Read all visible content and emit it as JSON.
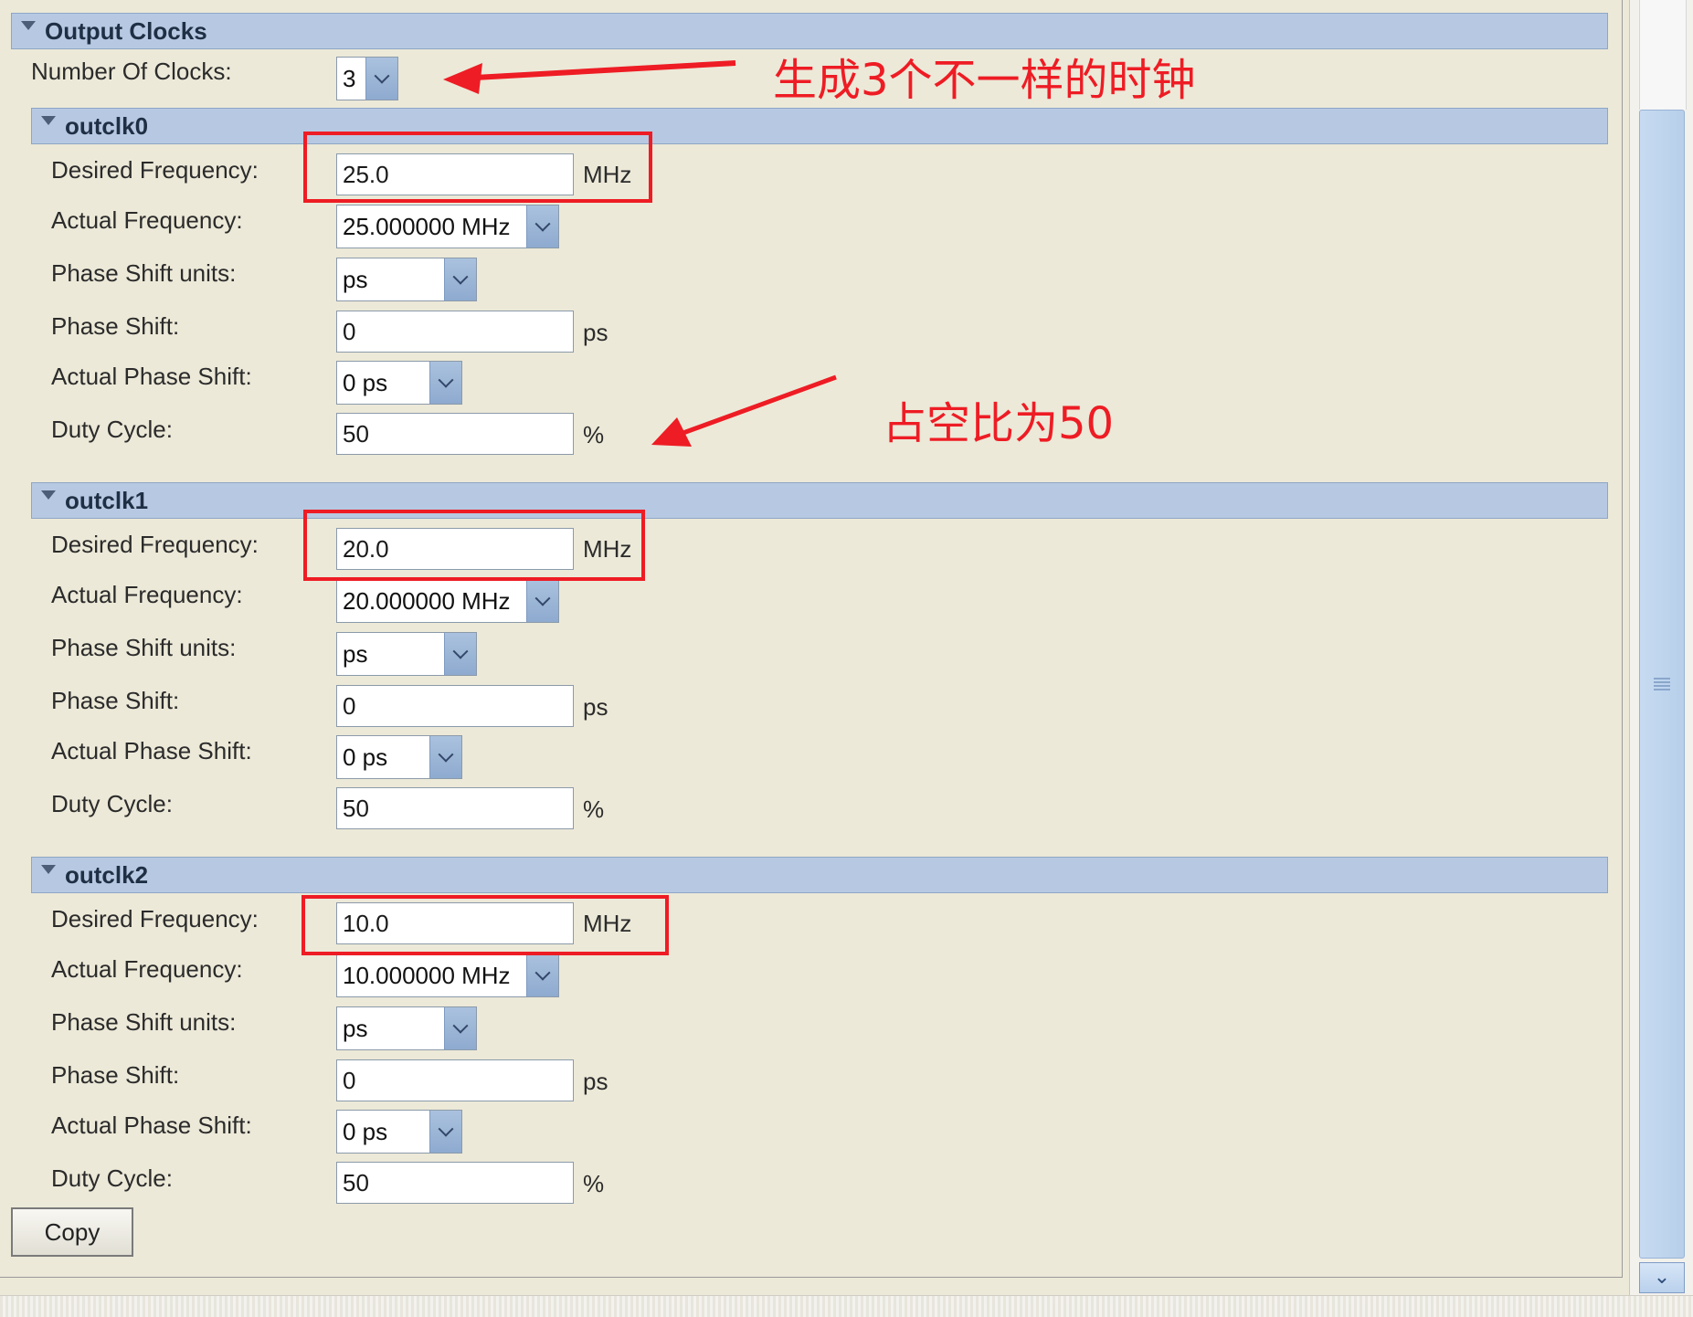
{
  "header": {
    "title": "Output Clocks"
  },
  "number_of_clocks": {
    "label": "Number Of Clocks:",
    "value": "3"
  },
  "clocks": [
    {
      "name": "outclk0",
      "desired_label": "Desired Frequency:",
      "desired_value": "25.0",
      "desired_unit": "MHz",
      "actual_label": "Actual Frequency:",
      "actual_value": "25.000000 MHz",
      "units_label": "Phase Shift units:",
      "units_value": "ps",
      "phase_label": "Phase Shift:",
      "phase_value": "0",
      "phase_unit": "ps",
      "actual_phase_label": "Actual Phase Shift:",
      "actual_phase_value": "0 ps",
      "duty_label": "Duty Cycle:",
      "duty_value": "50",
      "duty_unit": "%"
    },
    {
      "name": "outclk1",
      "desired_label": "Desired Frequency:",
      "desired_value": "20.0",
      "desired_unit": "MHz",
      "actual_label": "Actual Frequency:",
      "actual_value": "20.000000 MHz",
      "units_label": "Phase Shift units:",
      "units_value": "ps",
      "phase_label": "Phase Shift:",
      "phase_value": "0",
      "phase_unit": "ps",
      "actual_phase_label": "Actual Phase Shift:",
      "actual_phase_value": "0 ps",
      "duty_label": "Duty Cycle:",
      "duty_value": "50",
      "duty_unit": "%"
    },
    {
      "name": "outclk2",
      "desired_label": "Desired Frequency:",
      "desired_value": "10.0",
      "desired_unit": "MHz",
      "actual_label": "Actual Frequency:",
      "actual_value": "10.000000 MHz",
      "units_label": "Phase Shift units:",
      "units_value": "ps",
      "phase_label": "Phase Shift:",
      "phase_value": "0",
      "phase_unit": "ps",
      "actual_phase_label": "Actual Phase Shift:",
      "actual_phase_value": "0 ps",
      "duty_label": "Duty Cycle:",
      "duty_value": "50",
      "duty_unit": "%"
    }
  ],
  "copy_button": "Copy",
  "annotations": {
    "generate": "生成3个不一样的时钟",
    "duty": "占空比为50"
  },
  "colors": {
    "annotation_red": "#ee1c24",
    "header_blue": "#b7c9e2",
    "panel_bg": "#ece9d8"
  },
  "icons": [
    "collapse-triangle-icon",
    "chevron-down-icon",
    "scroll-down-arrow-icon",
    "scroll-grip-icon"
  ]
}
